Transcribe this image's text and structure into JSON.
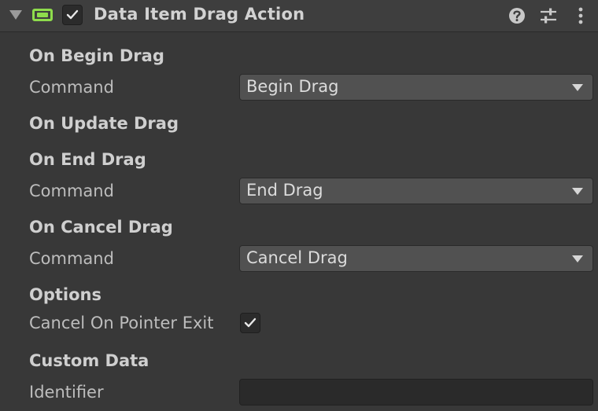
{
  "header": {
    "title": "Data Item Drag Action",
    "enabled": true,
    "icons": [
      "foldout-arrow-icon",
      "component-icon",
      "help-icon",
      "presets-icon",
      "more-menu-icon"
    ]
  },
  "sections": {
    "begin": {
      "title": "On Begin Drag",
      "command_label": "Command",
      "command_value": "Begin Drag"
    },
    "update": {
      "title": "On Update Drag"
    },
    "end": {
      "title": "On End Drag",
      "command_label": "Command",
      "command_value": "End Drag"
    },
    "cancel": {
      "title": "On Cancel Drag",
      "command_label": "Command",
      "command_value": "Cancel Drag"
    },
    "options": {
      "title": "Options",
      "cancel_on_exit_label": "Cancel On Pointer Exit",
      "cancel_on_exit_checked": true
    },
    "custom": {
      "title": "Custom Data",
      "identifier_label": "Identifier",
      "identifier_value": ""
    }
  },
  "colors": {
    "background": "#383838",
    "header": "#3e3e3e",
    "accent": "#8edc4c",
    "dropdown": "#515151"
  }
}
